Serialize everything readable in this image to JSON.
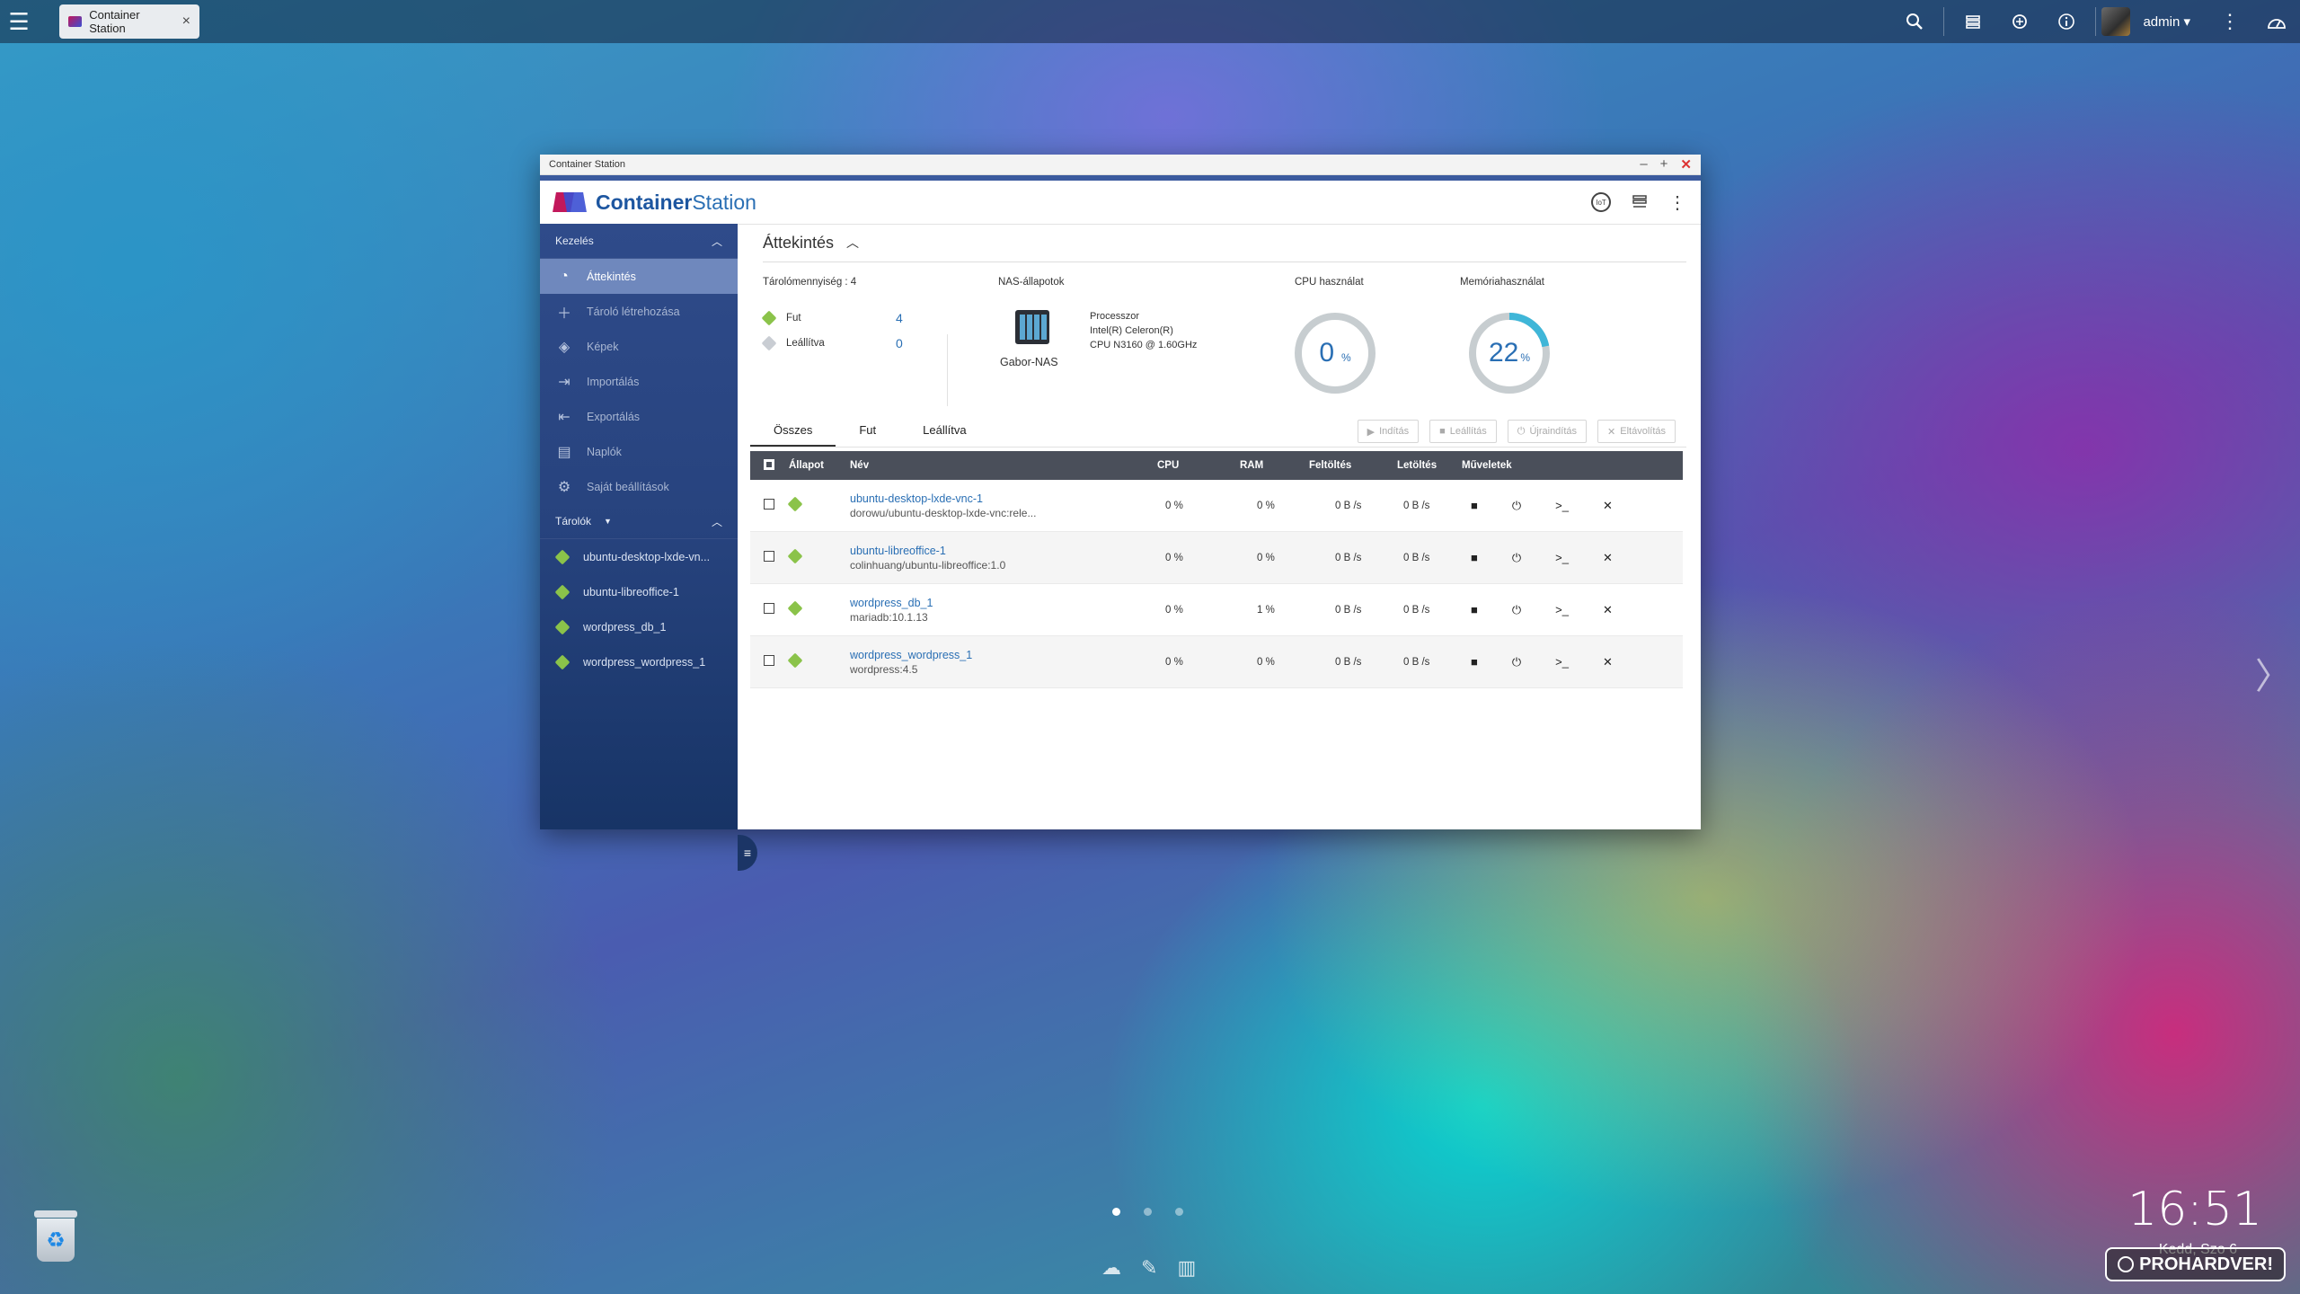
{
  "taskbar": {
    "tab_title": "Container Station",
    "user": "admin ▾"
  },
  "window": {
    "title": "Container Station",
    "app_name_bold": "Container",
    "app_name_rest": "Station",
    "iot_label": "IoT"
  },
  "sidebar": {
    "section_manage": "Kezelés",
    "items": [
      {
        "label": "Áttekintés",
        "icon": "gauge-icon"
      },
      {
        "label": "Tároló létrehozása",
        "icon": "plus-icon"
      },
      {
        "label": "Képek",
        "icon": "layers-icon"
      },
      {
        "label": "Importálás",
        "icon": "import-icon"
      },
      {
        "label": "Exportálás",
        "icon": "export-icon"
      },
      {
        "label": "Naplók",
        "icon": "log-icon"
      },
      {
        "label": "Saját beállítások",
        "icon": "gear-icon"
      }
    ],
    "section_containers": "Tárolók",
    "containers": [
      "ubuntu-desktop-lxde-vn...",
      "ubuntu-libreoffice-1",
      "wordpress_db_1",
      "wordpress_wordpress_1"
    ]
  },
  "overview": {
    "title": "Áttekintés",
    "container_count_label": "Tárolómennyiség : 4",
    "running_label": "Fut",
    "running_value": "4",
    "stopped_label": "Leállítva",
    "stopped_value": "0",
    "nas_status_label": "NAS-állapotok",
    "nas_name": "Gabor-NAS",
    "processor_label": "Processzor",
    "processor_line1": "Intel(R) Celeron(R)",
    "processor_line2": "CPU N3160 @ 1.60GHz",
    "cpu_label": "CPU használat",
    "cpu_value": "0",
    "cpu_percent": 0,
    "mem_label": "Memóriahasználat",
    "mem_value": "22",
    "mem_percent": 22,
    "percent_sign": "%"
  },
  "tabs": [
    "Összes",
    "Fut",
    "Leállítva"
  ],
  "actions": [
    "Indítás",
    "Leállítás",
    "Újraindítás",
    "Eltávolítás"
  ],
  "table": {
    "headers": [
      "Állapot",
      "Név",
      "CPU",
      "RAM",
      "Feltöltés",
      "Letöltés",
      "Műveletek"
    ],
    "rows": [
      {
        "name": "ubuntu-desktop-lxde-vnc-1",
        "image": "dorowu/ubuntu-desktop-lxde-vnc:rele...",
        "cpu": "0 %",
        "ram": "0 %",
        "up": "0 B /s",
        "down": "0 B /s"
      },
      {
        "name": "ubuntu-libreoffice-1",
        "image": "colinhuang/ubuntu-libreoffice:1.0",
        "cpu": "0 %",
        "ram": "0 %",
        "up": "0 B /s",
        "down": "0 B /s"
      },
      {
        "name": "wordpress_db_1",
        "image": "mariadb:10.1.13",
        "cpu": "0 %",
        "ram": "1 %",
        "up": "0 B /s",
        "down": "0 B /s"
      },
      {
        "name": "wordpress_wordpress_1",
        "image": "wordpress:4.5",
        "cpu": "0 %",
        "ram": "0 %",
        "up": "0 B /s",
        "down": "0 B /s"
      }
    ]
  },
  "desktop": {
    "clock": "16:51",
    "date": "Kedd, Szo 6",
    "watermark": "PROHARDVER!"
  },
  "colors": {
    "accent": "#2a6fb4",
    "sidebar": "#27437e",
    "running": "#8bc34a",
    "gauge_track": "#c7cdd0",
    "gauge_fill": "#3fb6d8"
  }
}
